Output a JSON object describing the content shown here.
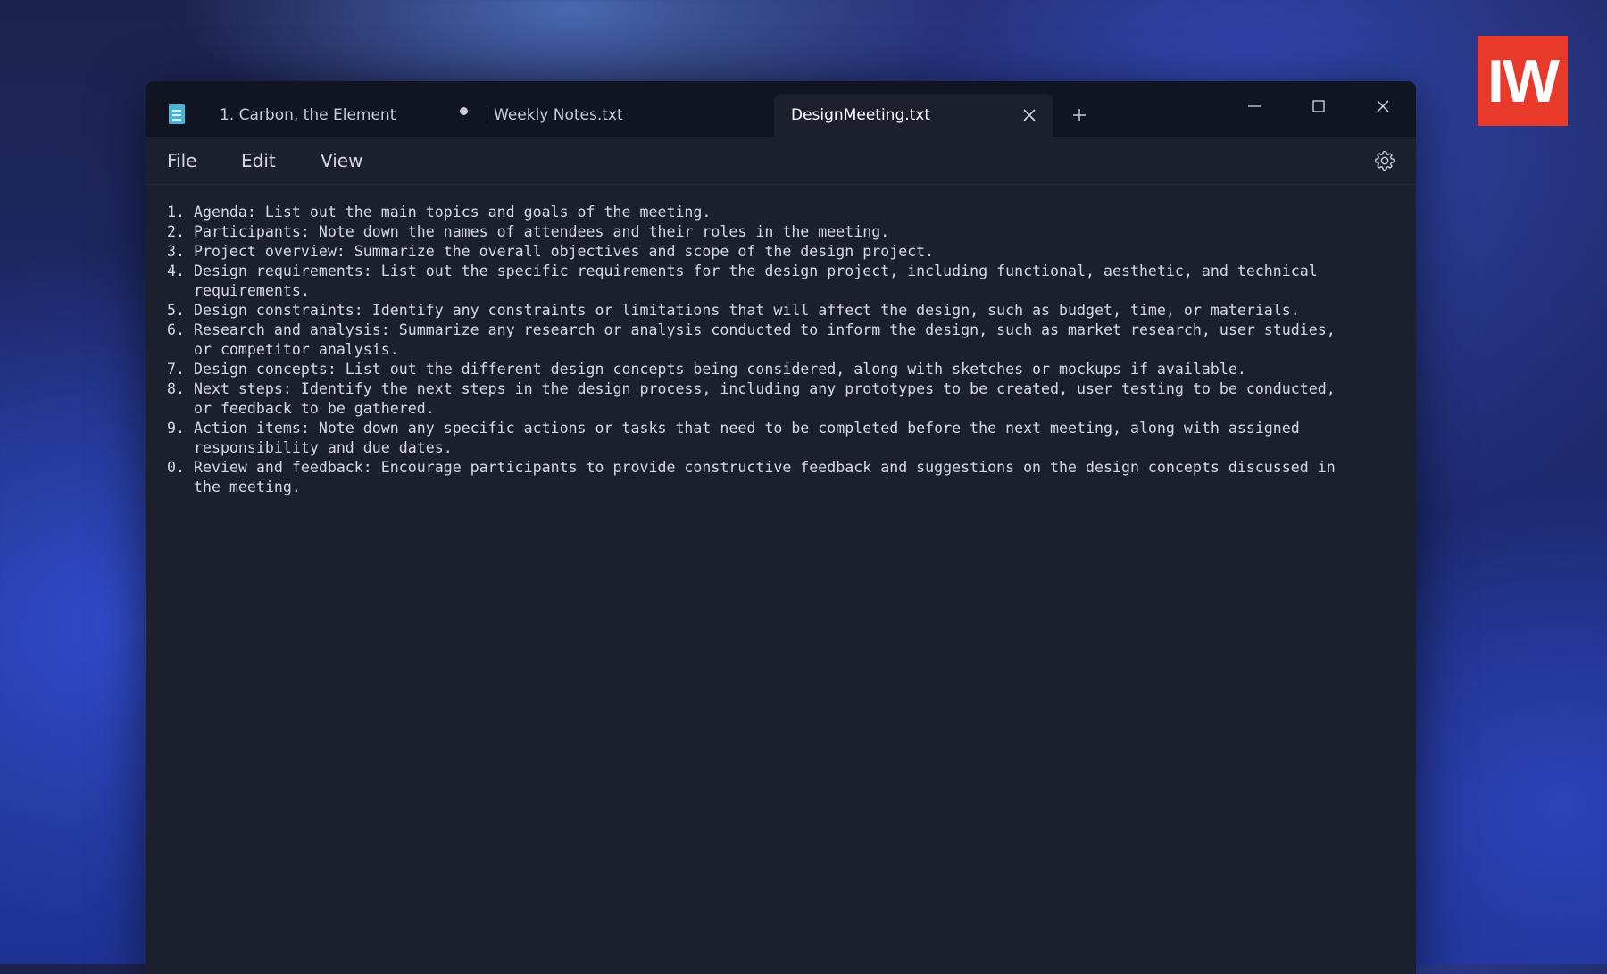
{
  "logo": {
    "text": "IW",
    "color": "#e8392b"
  },
  "window": {
    "app_icon": "notepad-icon",
    "tabs": [
      {
        "label": "1. Carbon, the Element",
        "unsaved": true
      },
      {
        "label": "Weekly Notes.txt"
      },
      {
        "label": "DesignMeeting.txt",
        "active": true
      }
    ],
    "controls": [
      "minimize-icon",
      "maximize-icon",
      "close-icon"
    ]
  },
  "menu": {
    "file": "File",
    "edit": "Edit",
    "view": "View",
    "settings_icon": "gear-icon"
  },
  "editor": {
    "lines": [
      "1. Agenda: List out the main topics and goals of the meeting.",
      "2. Participants: Note down the names of attendees and their roles in the meeting.",
      "3. Project overview: Summarize the overall objectives and scope of the design project.",
      "4. Design requirements: List out the specific requirements for the design project, including functional, aesthetic, and technical",
      "   requirements.",
      "5. Design constraints: Identify any constraints or limitations that will affect the design, such as budget, time, or materials.",
      "6. Research and analysis: Summarize any research or analysis conducted to inform the design, such as market research, user studies,",
      "   or competitor analysis.",
      "7. Design concepts: List out the different design concepts being considered, along with sketches or mockups if available.",
      "8. Next steps: Identify the next steps in the design process, including any prototypes to be created, user testing to be conducted,",
      "   or feedback to be gathered.",
      "9. Action items: Note down any specific actions or tasks that need to be completed before the next meeting, along with assigned",
      "   responsibility and due dates.",
      "0. Review and feedback: Encourage participants to provide constructive feedback and suggestions on the design concepts discussed in",
      "   the meeting."
    ]
  }
}
